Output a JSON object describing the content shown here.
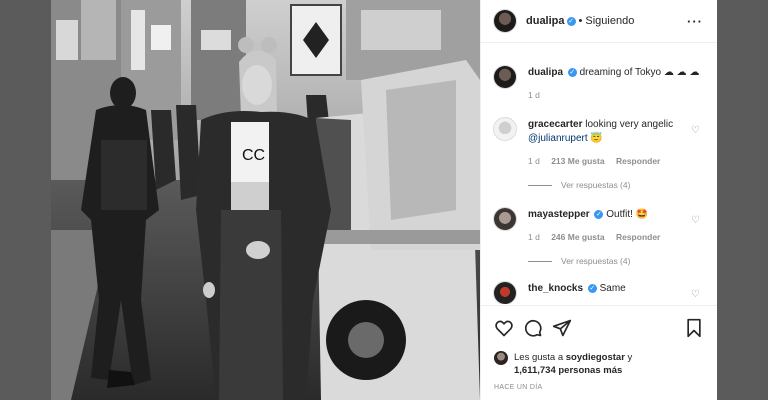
{
  "header": {
    "username": "dualipa",
    "verified_mark": "✓",
    "separator": "•",
    "follow_status": "Siguiendo",
    "more_label": "···"
  },
  "caption": {
    "username": "dualipa",
    "text": "dreaming of Tokyo ☁ ☁ ☁",
    "time": "1 d"
  },
  "comments": [
    {
      "username": "gracecarter",
      "text": " looking very angelic ",
      "mention": "@julianrupert",
      "emoji": " 😇",
      "time": "1 d",
      "likes": "213 Me gusta",
      "reply": "Responder",
      "view_replies": "Ver respuestas (4)"
    },
    {
      "username": "mayastepper",
      "text": " Outfit! ",
      "emoji": "🤩",
      "time": "1 d",
      "likes": "246 Me gusta",
      "reply": "Responder",
      "view_replies": "Ver respuestas (4)"
    },
    {
      "username": "the_knocks",
      "text": " Same"
    }
  ],
  "likes_line": {
    "prefix": "Les gusta a ",
    "user": "soydiegostar",
    "mid": " y ",
    "count": "1,611,734 personas más"
  },
  "timestamp": "HACE UN DÍA",
  "icons": [
    "heart-icon",
    "comment-icon",
    "share-icon",
    "bookmark-icon"
  ],
  "colors": {
    "verified": "#3897f0",
    "mention": "#00376b",
    "muted": "#8e8e8e"
  }
}
